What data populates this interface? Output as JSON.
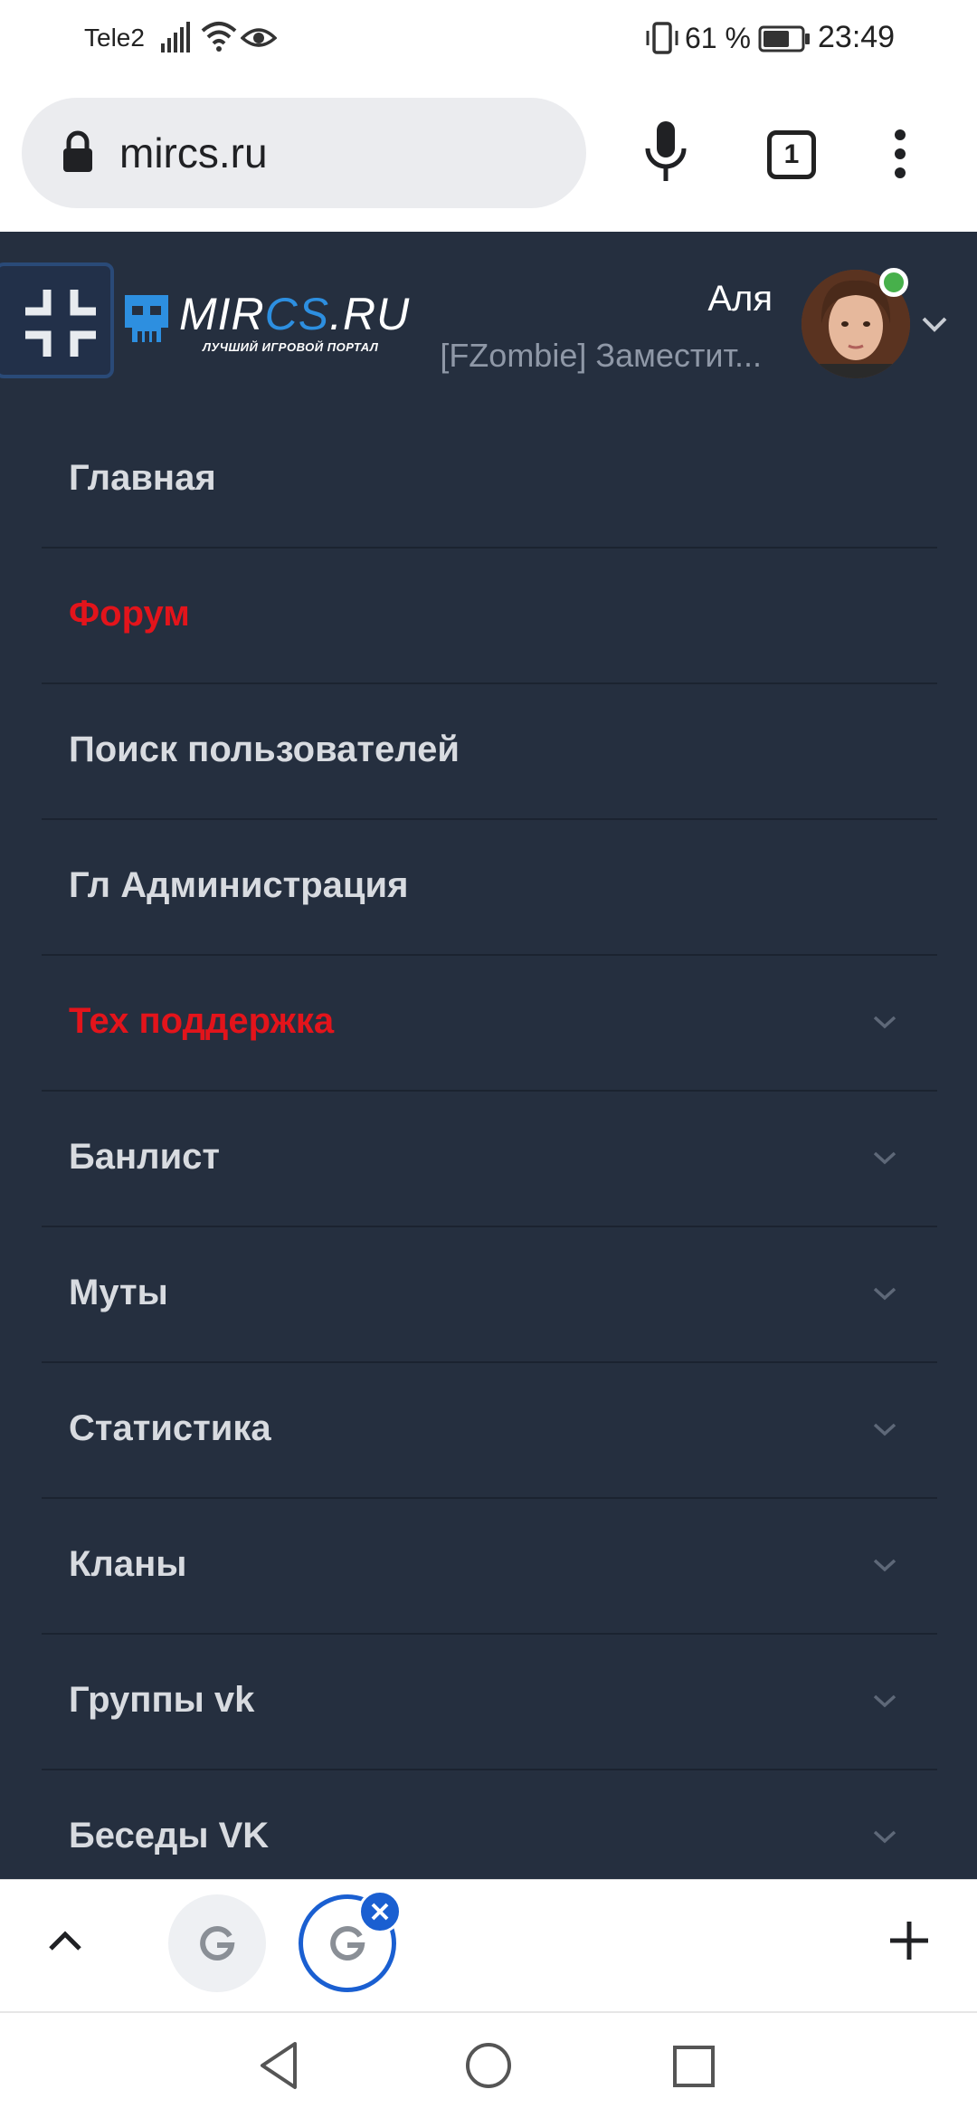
{
  "status_bar": {
    "carrier": "Tele2",
    "battery_percent": "61 %",
    "time": "23:49"
  },
  "browser": {
    "url": "mircs.ru",
    "tab_count": "1"
  },
  "site": {
    "logo": {
      "text_main": "MIR",
      "text_accent": "CS",
      "text_tail": ".RU",
      "tagline": "ЛУЧШИЙ ИГРОВОЙ ПОРТАЛ"
    },
    "user": {
      "name": "Аля",
      "role": "[FZombie] Заместит..."
    },
    "menu": [
      {
        "label": "Главная",
        "highlight": false,
        "has_submenu": false
      },
      {
        "label": "Форум",
        "highlight": true,
        "has_submenu": false
      },
      {
        "label": "Поиск пользователей",
        "highlight": false,
        "has_submenu": false
      },
      {
        "label": "Гл Администрация",
        "highlight": false,
        "has_submenu": false
      },
      {
        "label": "Тех поддержка",
        "highlight": true,
        "has_submenu": true
      },
      {
        "label": "Банлист",
        "highlight": false,
        "has_submenu": true
      },
      {
        "label": "Муты",
        "highlight": false,
        "has_submenu": true
      },
      {
        "label": "Статистика",
        "highlight": false,
        "has_submenu": true
      },
      {
        "label": "Кланы",
        "highlight": false,
        "has_submenu": true
      },
      {
        "label": "Группы vk",
        "highlight": false,
        "has_submenu": true
      },
      {
        "label": "Беседы VK",
        "highlight": false,
        "has_submenu": true
      }
    ]
  },
  "colors": {
    "site_background": "#252f3f",
    "menu_text": "#d8dbe0",
    "menu_highlight": "#e3141b",
    "logo_accent": "#2d8fe0",
    "online_status": "#47b04b",
    "active_tab_ring": "#1a5fd1"
  }
}
